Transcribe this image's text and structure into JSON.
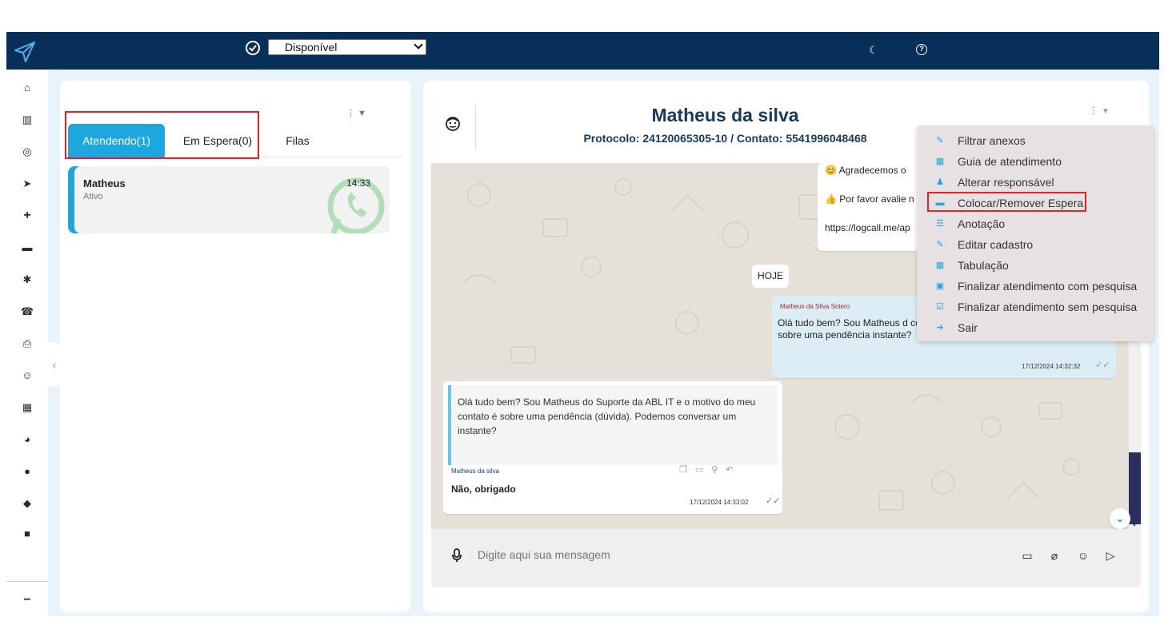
{
  "topbar": {
    "status_select": "Disponível",
    "colors": {
      "bar": "#082f58",
      "accent": "#1ea7df",
      "highlight": "#e5202a"
    }
  },
  "sidebar": {
    "icons": [
      "home-icon",
      "chart-icon",
      "whatsapp-icon",
      "send-icon",
      "plus-icon",
      "briefcase-icon",
      "gear-icon",
      "phone-icon",
      "printer-icon",
      "smile-icon",
      "calendar-icon",
      "dashboard-icon",
      "comments-icon",
      "comment-icon",
      "video-icon",
      "minus-icon"
    ]
  },
  "left_panel": {
    "tabs": [
      {
        "label": "Atendendo(1)",
        "active": true
      },
      {
        "label": "Em Espera(0)",
        "active": false
      },
      {
        "label": "Filas",
        "active": false
      }
    ],
    "chats": [
      {
        "name": "Matheus",
        "status": "Ativo",
        "time": "14:33",
        "channel_icon": "whatsapp-icon"
      }
    ]
  },
  "conversation": {
    "contact_name": "Matheus da silva",
    "protocol": "Protocolo: 24120065305-10 / Contato: 5541996048468",
    "messages": [
      {
        "line1": "😊 Agradecemos o",
        "line2": "👍 Por favor avalie n",
        "line3": "https://logcall.me/ap"
      },
      {
        "type": "date",
        "text": "HOJE"
      },
      {
        "sender": "Matheus da Silva Sotero",
        "text": " Olá tudo bem? Sou Matheus  d contato é sobre uma pendência instante?",
        "timestamp": "17/12/2024 14:32:32"
      },
      {
        "quote": "Olá tudo bem? Sou Matheus  do Suporte da ABL IT e o motivo do meu contato é sobre uma pendência (dúvida). Podemos conversar um instante?",
        "sender": "Matheus da silva",
        "text": "Não, obrigado",
        "timestamp": "17/12/2024 14:33:02"
      }
    ],
    "composer_placeholder": "Digite aqui sua mensagem"
  },
  "menu": {
    "items": [
      {
        "label": "Filtrar anexos",
        "icon": "paperclip-icon",
        "highlighted": false
      },
      {
        "label": "Guia de atendimento",
        "icon": "calendar-icon",
        "highlighted": false
      },
      {
        "label": "Alterar responsável",
        "icon": "user-plus-icon",
        "highlighted": false
      },
      {
        "label": "Colocar/Remover Espera",
        "icon": "bed-icon",
        "highlighted": true
      },
      {
        "label": "Anotação",
        "icon": "list-icon",
        "highlighted": false
      },
      {
        "label": "Editar cadastro",
        "icon": "edit-icon",
        "highlighted": false
      },
      {
        "label": "Tabulação",
        "icon": "grid-icon",
        "highlighted": false
      },
      {
        "label": "Finalizar atendimento com pesquisa",
        "icon": "calendar-check-icon",
        "highlighted": false
      },
      {
        "label": "Finalizar atendimento sem pesquisa",
        "icon": "check-square-icon",
        "highlighted": false
      },
      {
        "label": "Sair",
        "icon": "exit-icon",
        "highlighted": false
      }
    ]
  }
}
